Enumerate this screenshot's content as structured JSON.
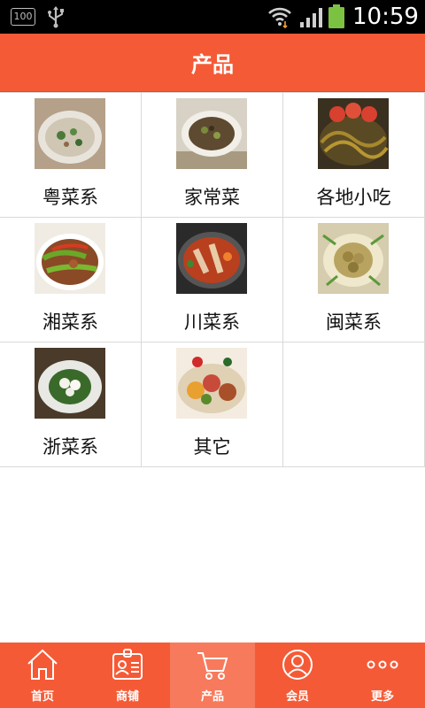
{
  "status_bar": {
    "battery_level_badge": "100",
    "time": "10:59",
    "icons": [
      "battery-level-icon",
      "usb-icon",
      "wifi-icon",
      "signal-icon",
      "battery-icon"
    ]
  },
  "title_bar": {
    "title": "产品"
  },
  "categories": [
    {
      "label": "粤菜系",
      "image": "dish-photo-cantonese"
    },
    {
      "label": "家常菜",
      "image": "dish-photo-homestyle"
    },
    {
      "label": "各地小吃",
      "image": "dish-photo-snacks"
    },
    {
      "label": "湘菜系",
      "image": "dish-photo-hunan"
    },
    {
      "label": "川菜系",
      "image": "dish-photo-sichuan"
    },
    {
      "label": "闽菜系",
      "image": "dish-photo-fujian"
    },
    {
      "label": "浙菜系",
      "image": "dish-photo-zhejiang"
    },
    {
      "label": "其它",
      "image": "dish-photo-other"
    }
  ],
  "tab_bar": {
    "tabs": [
      {
        "label": "首页",
        "icon": "home-icon"
      },
      {
        "label": "商铺",
        "icon": "store-card-icon"
      },
      {
        "label": "产品",
        "icon": "cart-icon"
      },
      {
        "label": "会员",
        "icon": "member-icon"
      },
      {
        "label": "更多",
        "icon": "more-icon"
      }
    ],
    "active": "产品"
  },
  "colors": {
    "accent": "#f55a36",
    "active_tab": "#f77a5c",
    "divider": "#d9d9d9"
  }
}
